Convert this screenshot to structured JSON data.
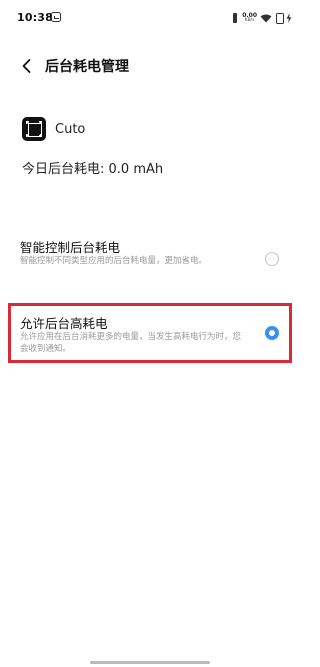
{
  "status_bar": {
    "time": "10:38",
    "net_speed_value": "0.00",
    "net_speed_unit": "KB/s",
    "icons": [
      "notification-icon",
      "vibrate-icon",
      "wifi-icon",
      "battery-icon",
      "charging-icon"
    ]
  },
  "header": {
    "back_icon": "chevron-left-icon",
    "title": "后台耗电管理"
  },
  "app": {
    "icon": "cuto-app-icon",
    "name": "Cuto"
  },
  "usage": {
    "text": "今日后台耗电: 0.0 mAh"
  },
  "options": [
    {
      "title": "智能控制后台耗电",
      "description": "智能控制不同类型应用的后台耗电量，更加省电。",
      "selected": false
    },
    {
      "title": "允许后台高耗电",
      "description": "允许应用在后台消耗更多的电量，当发生高耗电行为时，您会收到通知。",
      "selected": true
    }
  ],
  "colors": {
    "accent": "#3b8ff0",
    "highlight_border": "#d92a35",
    "secondary_text": "#9a9a9a"
  }
}
